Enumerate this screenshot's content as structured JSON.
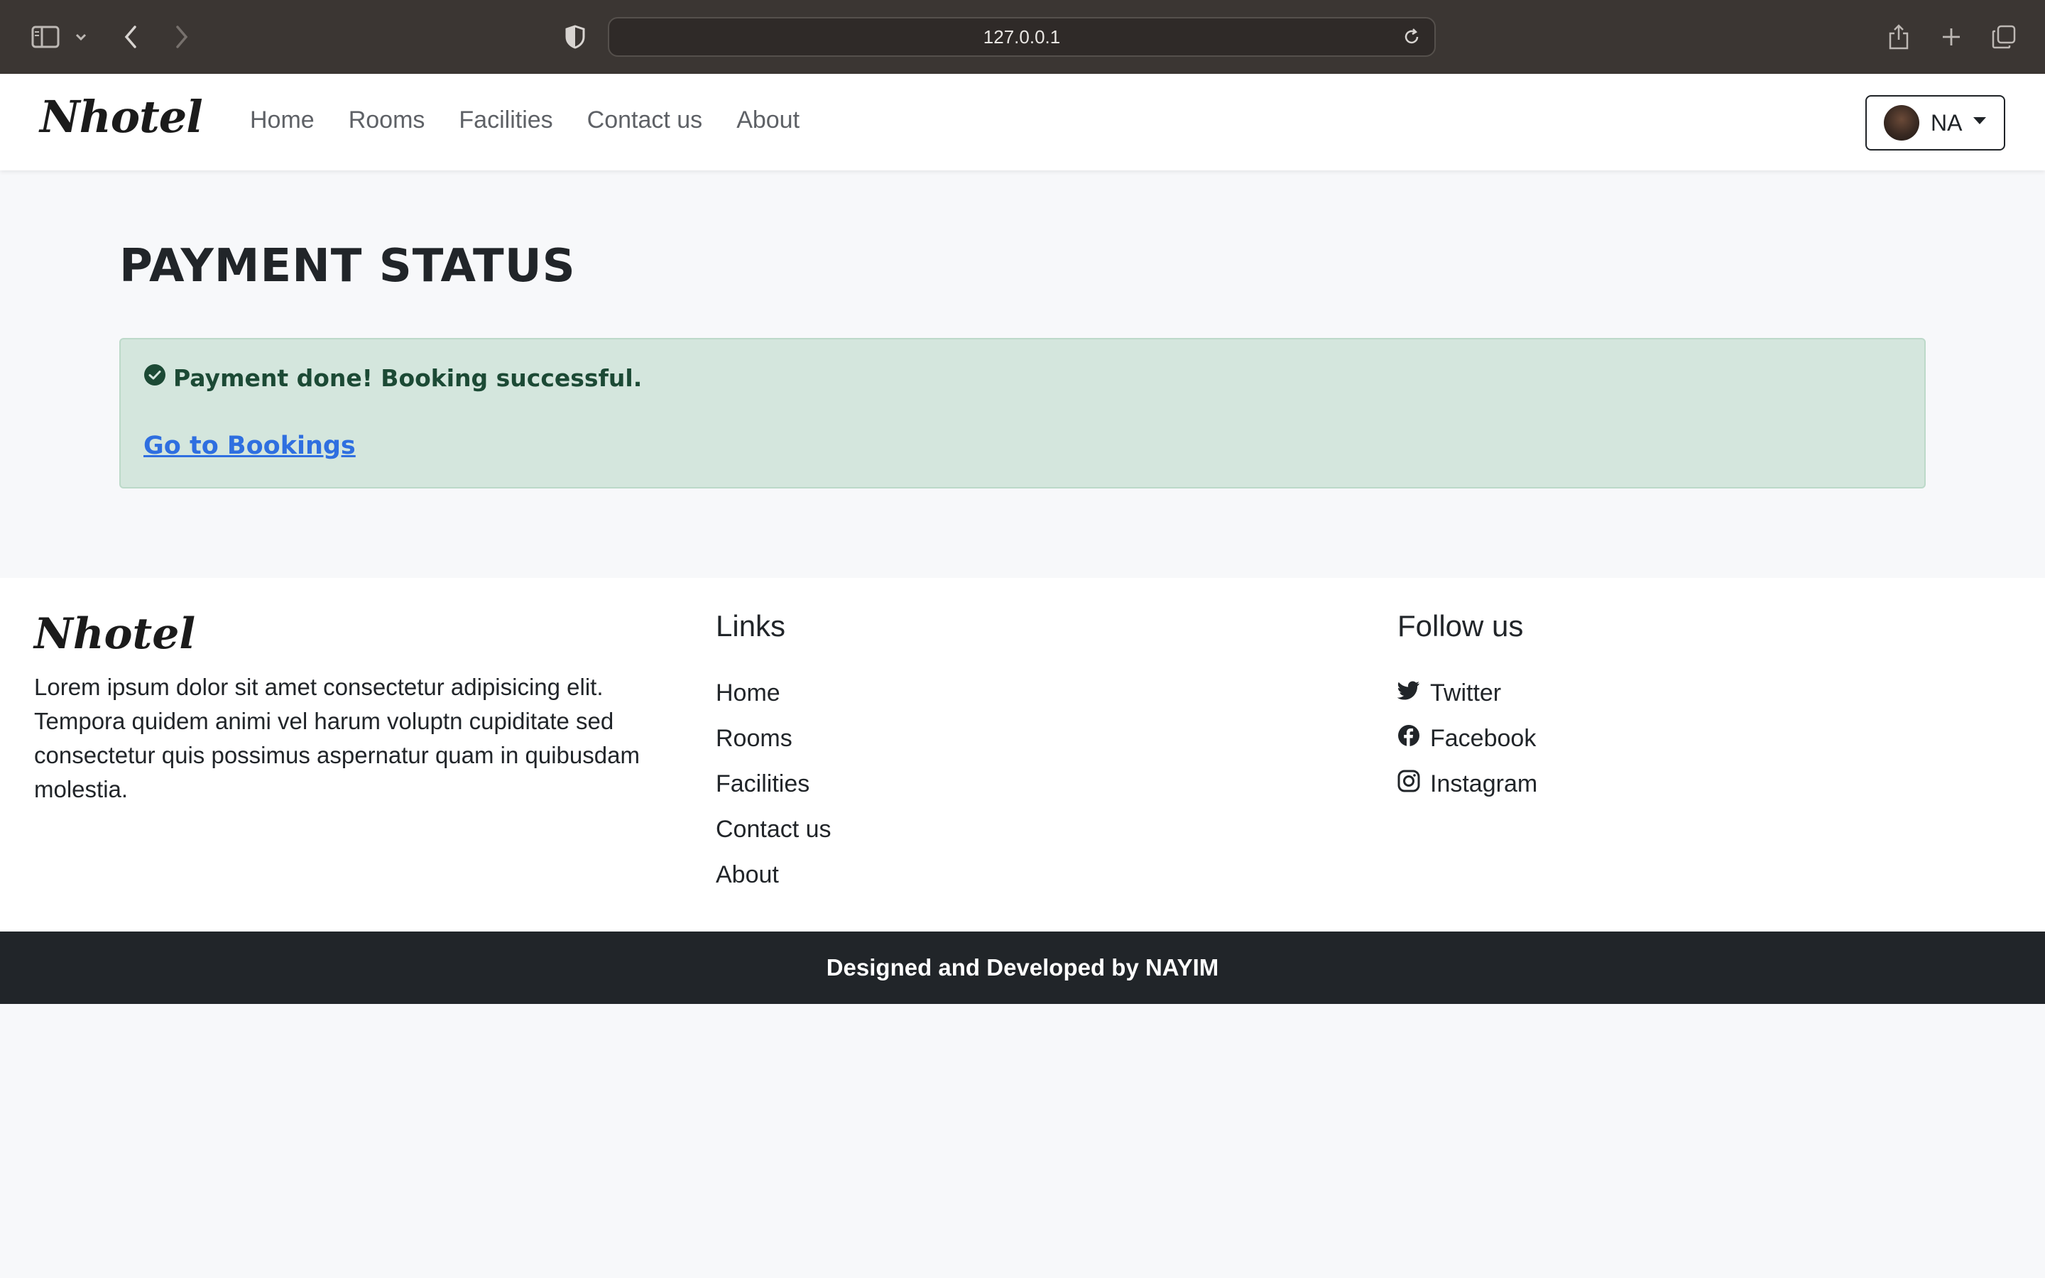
{
  "browser": {
    "url": "127.0.0.1",
    "icons": [
      "sidebar-icon",
      "chevron-down-icon",
      "back-icon",
      "forward-icon",
      "shield-icon",
      "reload-icon",
      "share-icon",
      "new-tab-icon",
      "tabs-overview-icon"
    ]
  },
  "navbar": {
    "brand": "Nhotel",
    "links": [
      "Home",
      "Rooms",
      "Facilities",
      "Contact us",
      "About"
    ],
    "user": {
      "initials": "NA"
    }
  },
  "main": {
    "title": "PAYMENT STATUS",
    "alert": {
      "message": "Payment done! Booking successful.",
      "link": "Go to Bookings",
      "icon": "check-circle-icon"
    }
  },
  "footer": {
    "brand": "Nhotel",
    "description": "Lorem ipsum dolor sit amet consectetur adipisicing elit. Tempora quidem animi vel harum voluptn cupiditate sed consectetur quis possimus aspernatur quam in quibusdam molestia.",
    "links_title": "Links",
    "links": [
      "Home",
      "Rooms",
      "Facilities",
      "Contact us",
      "About"
    ],
    "follow_title": "Follow us",
    "social": [
      {
        "label": "Twitter",
        "icon": "twitter-icon"
      },
      {
        "label": "Facebook",
        "icon": "facebook-icon"
      },
      {
        "label": "Instagram",
        "icon": "instagram-icon"
      }
    ],
    "credit": "Designed and Developed by NAYIM"
  },
  "colors": {
    "chrome": "#3b3633",
    "alert_bg": "#d4e6dd",
    "alert_text": "#1c4a35",
    "link": "#2f6fe0",
    "footer_bar": "#212529"
  }
}
